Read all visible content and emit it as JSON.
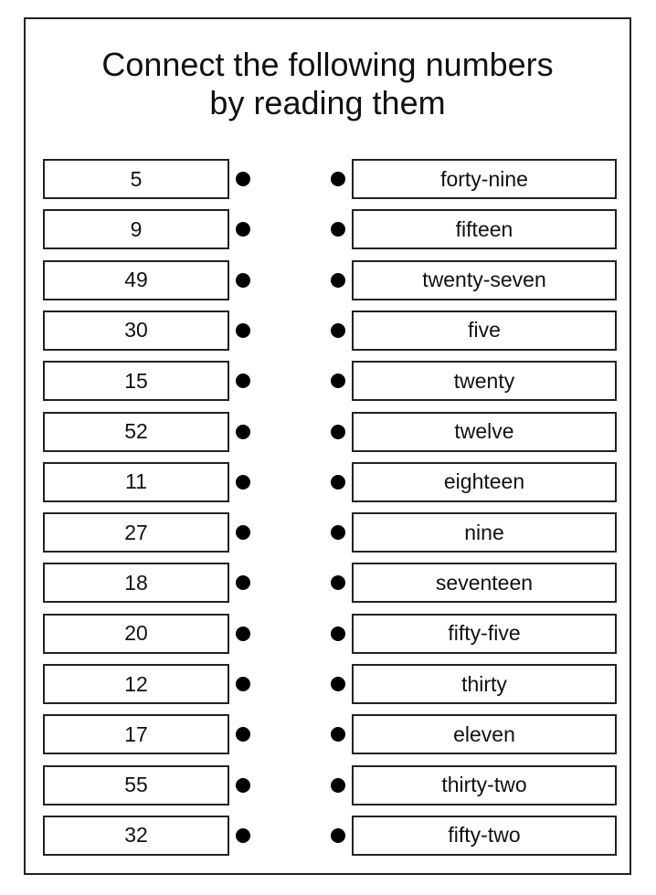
{
  "worksheet": {
    "title_line1": "Connect the following numbers",
    "title_line2": "by reading them",
    "numbers": [
      "5",
      "9",
      "49",
      "30",
      "15",
      "52",
      "11",
      "27",
      "18",
      "20",
      "12",
      "17",
      "55",
      "32"
    ],
    "words": [
      "forty-nine",
      "fifteen",
      "twenty-seven",
      "five",
      "twenty",
      "twelve",
      "eighteen",
      "nine",
      "seventeen",
      "fifty-five",
      "thirty",
      "eleven",
      "thirty-two",
      "fifty-two"
    ]
  }
}
